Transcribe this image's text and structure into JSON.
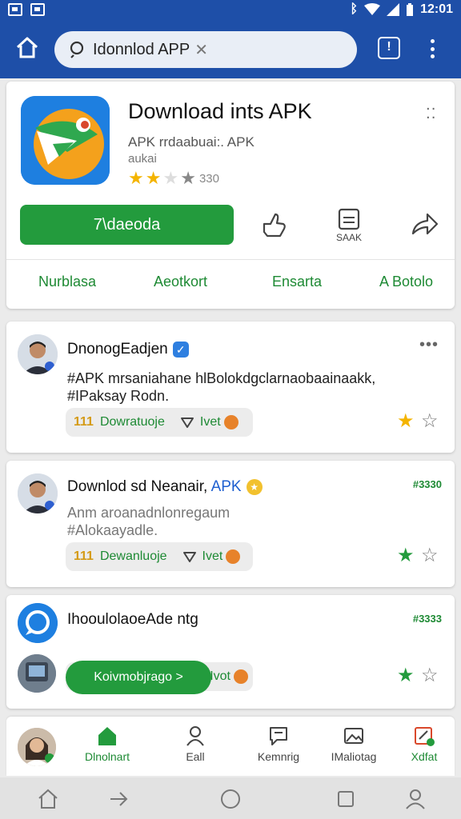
{
  "status_bar": {
    "time": "12:01"
  },
  "top_bar": {
    "search_text": "Idonnlod APP",
    "info_label": "!"
  },
  "app": {
    "title": "Download ints APK",
    "subtitle": "APK rrdaabuai:. APK",
    "subtitle2": "aukai",
    "rating_count": "330",
    "install_label": "7\\daeoda",
    "save_label": "SAAK",
    "tabs": [
      "Nurblasa",
      "Aeotkort",
      "Ensarta",
      "A Botolo"
    ]
  },
  "posts": [
    {
      "author": "DnonogEadjen",
      "text_line1": "#APK mrsaniahane hlBolokdgclarnaobaainaakk,",
      "text_line2": "#IPaksay Rodn.",
      "chip_count": "111",
      "chip_label": "Dowratuoje",
      "chip_secondary": "Ivet"
    },
    {
      "author_prefix": "Downlod sd Neanair, ",
      "author_highlight": "APK",
      "count": "#3330",
      "text_line1": "Anm aroanadnlonregaum",
      "text_line2": "#Alokaayadle.",
      "chip_count": "111",
      "chip_label": "Dewanluoje",
      "chip_secondary": "Ivet"
    },
    {
      "author": "IhooulolaoeAde ntg",
      "count": "#3333",
      "cta_label": "Koivmobjrago >",
      "chip_secondary": "Ivot"
    }
  ],
  "bottom_nav": {
    "items": [
      {
        "label": "Dlnolnart",
        "icon": "home-icon"
      },
      {
        "label": "Eall",
        "icon": "person-icon"
      },
      {
        "label": "Kemnrig",
        "icon": "chat-icon"
      },
      {
        "label": "IMaliotag",
        "icon": "image-icon"
      },
      {
        "label": "Xdfat",
        "icon": "edit-icon"
      }
    ]
  },
  "colors": {
    "primary": "#1e4fa8",
    "accent_green": "#239b3d",
    "star_gold": "#f4b400"
  }
}
